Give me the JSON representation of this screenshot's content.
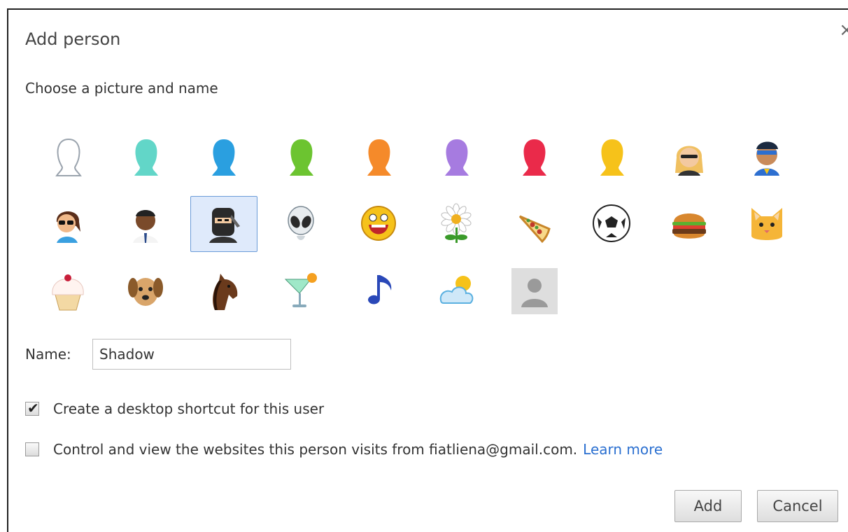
{
  "dialog": {
    "title": "Add person",
    "close_glyph": "×",
    "subtitle": "Choose a picture and name"
  },
  "avatars": [
    {
      "name": "avatar-white-silhouette-icon",
      "selected": false
    },
    {
      "name": "avatar-teal-silhouette-icon",
      "selected": false
    },
    {
      "name": "avatar-blue-silhouette-icon",
      "selected": false
    },
    {
      "name": "avatar-green-silhouette-icon",
      "selected": false
    },
    {
      "name": "avatar-orange-silhouette-icon",
      "selected": false
    },
    {
      "name": "avatar-purple-silhouette-icon",
      "selected": false
    },
    {
      "name": "avatar-red-silhouette-icon",
      "selected": false
    },
    {
      "name": "avatar-yellow-silhouette-icon",
      "selected": false
    },
    {
      "name": "avatar-businesswoman-icon",
      "selected": false
    },
    {
      "name": "avatar-superhero-icon",
      "selected": false
    },
    {
      "name": "avatar-woman-sunglasses-icon",
      "selected": false
    },
    {
      "name": "avatar-businessman-icon",
      "selected": false
    },
    {
      "name": "avatar-ninja-icon",
      "selected": true
    },
    {
      "name": "avatar-alien-icon",
      "selected": false
    },
    {
      "name": "avatar-smiley-icon",
      "selected": false
    },
    {
      "name": "avatar-flower-icon",
      "selected": false
    },
    {
      "name": "avatar-pizza-icon",
      "selected": false
    },
    {
      "name": "avatar-soccer-ball-icon",
      "selected": false
    },
    {
      "name": "avatar-burger-icon",
      "selected": false
    },
    {
      "name": "avatar-cat-icon",
      "selected": false
    },
    {
      "name": "avatar-cupcake-icon",
      "selected": false
    },
    {
      "name": "avatar-dog-icon",
      "selected": false
    },
    {
      "name": "avatar-horse-icon",
      "selected": false
    },
    {
      "name": "avatar-cocktail-icon",
      "selected": false
    },
    {
      "name": "avatar-music-note-icon",
      "selected": false
    },
    {
      "name": "avatar-weather-icon",
      "selected": false
    },
    {
      "name": "avatar-placeholder-icon",
      "selected": false
    }
  ],
  "name_field": {
    "label": "Name:",
    "value": "Shadow"
  },
  "options": {
    "desktop_shortcut": {
      "label": "Create a desktop shortcut for this user",
      "checked": true
    },
    "supervise": {
      "label": "Control and view the websites this person visits from fiatliena@gmail.com.",
      "checked": false,
      "link": "Learn more"
    }
  },
  "buttons": {
    "add": "Add",
    "cancel": "Cancel"
  },
  "colors": {
    "link": "#2a6fd0",
    "selection_border": "#6b9bd8",
    "selection_bg": "#dfeafb"
  }
}
